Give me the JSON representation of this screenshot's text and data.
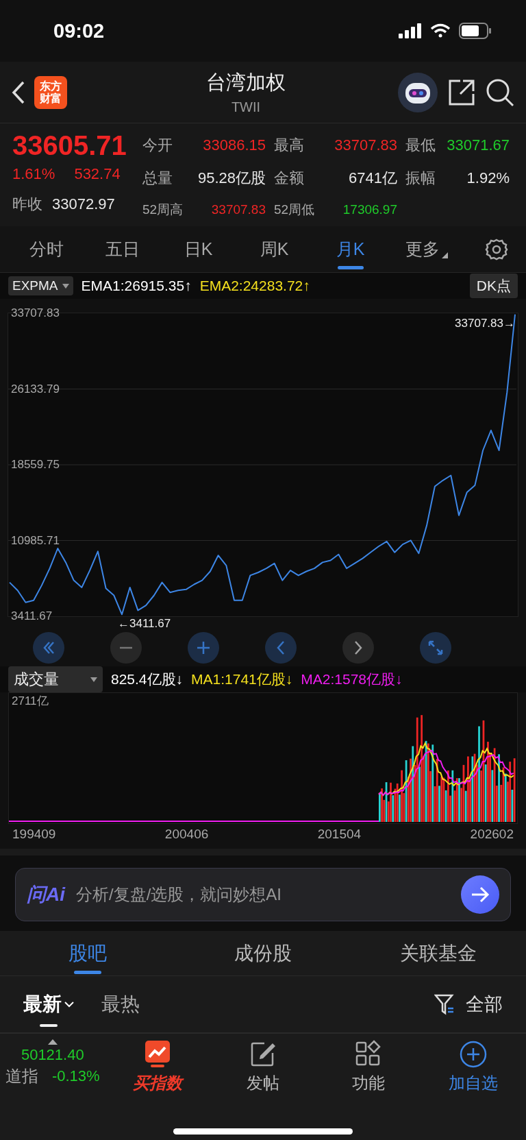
{
  "status_bar": {
    "time": "09:02"
  },
  "header": {
    "logo_lines": [
      "东方",
      "财富"
    ],
    "title": "台湾加权",
    "subtitle": "TWII"
  },
  "quote": {
    "price": {
      "text": "33605.71",
      "color": "#f02525"
    },
    "change_pct": {
      "text": "1.61%",
      "color": "#f02525"
    },
    "change": {
      "text": "532.74",
      "color": "#f02525"
    },
    "prev_close": {
      "label": "昨收",
      "value": "33072.97",
      "color": "#e8e8e8"
    },
    "stats": [
      {
        "label": "今开",
        "value": "33086.15",
        "color": "#f02525"
      },
      {
        "label": "最高",
        "value": "33707.83",
        "color": "#f02525"
      },
      {
        "label": "最低",
        "value": "33071.67",
        "color": "#1fcc2a"
      },
      {
        "label": "总量",
        "value": "95.28亿股",
        "color": "#e8e8e8"
      },
      {
        "label": "金额",
        "value": "6741亿",
        "color": "#e8e8e8"
      },
      {
        "label": "振幅",
        "value": "1.92%",
        "color": "#e8e8e8"
      },
      {
        "label": "52周高",
        "value": "33707.83",
        "color": "#f02525"
      },
      {
        "label": "52周低",
        "value": "17306.97",
        "color": "#1fcc2a"
      }
    ]
  },
  "period_tabs": [
    {
      "label": "分时",
      "selected": false,
      "menu": false
    },
    {
      "label": "五日",
      "selected": false,
      "menu": false
    },
    {
      "label": "日K",
      "selected": false,
      "menu": false
    },
    {
      "label": "周K",
      "selected": false,
      "menu": false
    },
    {
      "label": "月K",
      "selected": true,
      "menu": false
    },
    {
      "label": "更多",
      "selected": false,
      "menu": true
    }
  ],
  "indicator": {
    "name": "EXPMA",
    "values": [
      {
        "text": "EMA1:26915.35↑",
        "color": "#ffffff"
      },
      {
        "text": "EMA2:24283.72↑",
        "color": "#f5e11e"
      }
    ],
    "dk_button": "DK点"
  },
  "price_chart": {
    "max_label": "33707.83→",
    "min_label": "←3411.67",
    "chart_data": {
      "type": "line",
      "grid": true,
      "ylim": [
        3411.67,
        33707.83
      ],
      "yticks": [
        {
          "value": 33707.83,
          "label": "33707.83"
        },
        {
          "value": 26133.79,
          "label": "26133.79"
        },
        {
          "value": 18559.75,
          "label": "18559.75"
        },
        {
          "value": 10985.71,
          "label": "10985.71"
        },
        {
          "value": 3411.67,
          "label": "3411.67"
        }
      ],
      "series": [
        {
          "color": "#3d86e6",
          "values": [
            6800,
            6000,
            4800,
            5000,
            6500,
            8200,
            10200,
            8800,
            7000,
            6300,
            8000,
            9900,
            6200,
            5500,
            3600,
            6300,
            4000,
            4500,
            5500,
            6800,
            5800,
            6000,
            6100,
            6600,
            7000,
            7900,
            9500,
            8500,
            5000,
            5000,
            7500,
            7800,
            8200,
            8700,
            7000,
            8000,
            7500,
            7900,
            8200,
            8800,
            9000,
            9600,
            8200,
            8700,
            9200,
            9800,
            10400,
            10900,
            9800,
            10600,
            11000,
            9700,
            12500,
            16400,
            17000,
            17500,
            13500,
            15800,
            16500,
            20000,
            22000,
            20000,
            25800,
            33600
          ]
        }
      ]
    }
  },
  "volume": {
    "selector": "成交量",
    "values": [
      {
        "text": "825.4亿股↓",
        "color": "#ffffff"
      },
      {
        "text": "MA1:1741亿股↓",
        "color": "#f5e11e"
      },
      {
        "text": "MA2:1578亿股↓",
        "color": "#f01ef0"
      }
    ],
    "max_label": "2711亿",
    "x_labels": [
      "199409",
      "200406",
      "201504",
      "202602"
    ]
  },
  "ai_bar": {
    "brand": "问Ai",
    "placeholder": "分析/复盘/选股，就问妙想AI"
  },
  "section_tabs": [
    {
      "label": "股吧",
      "selected": true
    },
    {
      "label": "成份股",
      "selected": false
    },
    {
      "label": "关联基金",
      "selected": false
    }
  ],
  "sort_tabs": [
    {
      "label": "最新",
      "selected": true
    },
    {
      "label": "最热",
      "selected": false
    }
  ],
  "filter": {
    "label": "全部"
  },
  "ticker": {
    "value": "50121.40",
    "name": "道指",
    "change": "-0.13%",
    "color": "#1fcc2a"
  },
  "bottom_nav": [
    {
      "kind": "promo",
      "label": "买指数"
    },
    {
      "kind": "post",
      "label": "发帖"
    },
    {
      "kind": "function",
      "label": "功能"
    },
    {
      "kind": "add",
      "label": "加自选"
    }
  ]
}
